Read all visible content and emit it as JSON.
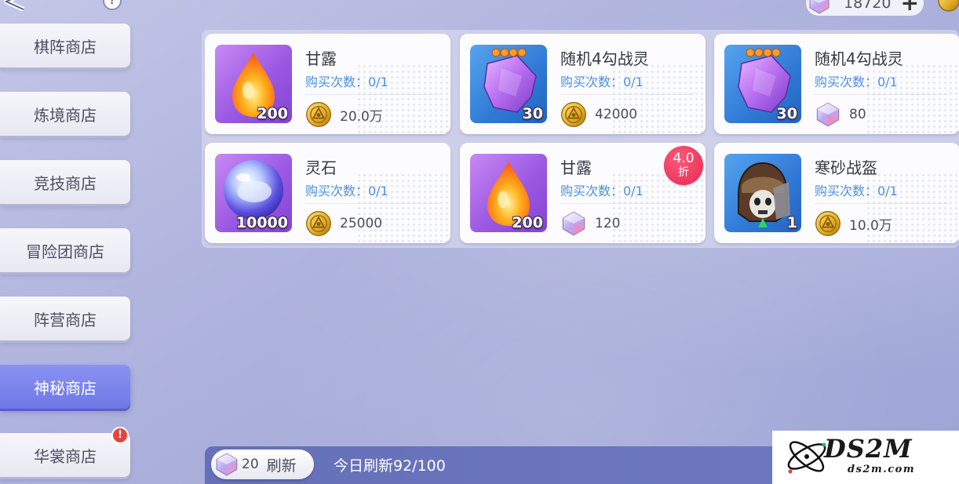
{
  "topbar": {
    "help_symbol": "?",
    "gem_value": "18720",
    "plus_symbol": "+"
  },
  "sidebar": {
    "items": [
      {
        "label": "棋阵商店",
        "active": false
      },
      {
        "label": "炼境商店",
        "active": false
      },
      {
        "label": "竞技商店",
        "active": false
      },
      {
        "label": "冒险团商店",
        "active": false
      },
      {
        "label": "阵营商店",
        "active": false
      },
      {
        "label": "神秘商店",
        "active": true
      },
      {
        "label": "华裳商店",
        "active": false,
        "badge": "!"
      }
    ]
  },
  "shop": {
    "items": [
      {
        "name": "甘露",
        "limit": "购买次数：0/1",
        "qty": "200",
        "icon": "nectar-drop-icon",
        "price": "20.0万",
        "currency": "gold-coin-icon"
      },
      {
        "name": "随机4勾战灵",
        "limit": "购买次数：0/1",
        "qty": "30",
        "icon": "war-spirit-shard-icon",
        "price": "42000",
        "currency": "gold-coin-icon"
      },
      {
        "name": "随机4勾战灵",
        "limit": "购买次数：0/1",
        "qty": "30",
        "icon": "war-spirit-shard-icon",
        "price": "80",
        "currency": "crystal-gem-icon"
      },
      {
        "name": "灵石",
        "limit": "购买次数：0/1",
        "qty": "10000",
        "icon": "spirit-stone-icon",
        "price": "25000",
        "currency": "gold-coin-icon"
      },
      {
        "name": "甘露",
        "limit": "购买次数：0/1",
        "qty": "200",
        "icon": "nectar-drop-icon",
        "price": "120",
        "currency": "crystal-gem-icon",
        "discount": "4.0",
        "discount_unit": "折"
      },
      {
        "name": "寒砂战盔",
        "limit": "购买次数：0/1",
        "qty": "1",
        "icon": "war-helmet-icon",
        "price": "10.0万",
        "currency": "gold-coin-icon"
      }
    ]
  },
  "refresh": {
    "cost": "20",
    "button_label": "刷新",
    "count_text": "今日刷新92/100"
  },
  "watermark": {
    "logo_text": "DS2M",
    "logo_sub": "ds2m.com"
  },
  "colors": {
    "accent": "#7a82ee",
    "limit_text": "#4b8fe3",
    "discount": "#e4284e",
    "refresh_bar": "#6570b8"
  }
}
